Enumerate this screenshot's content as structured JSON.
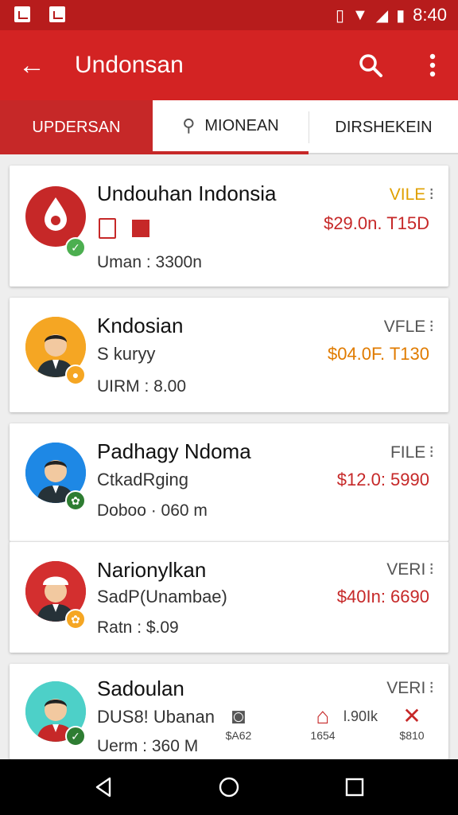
{
  "status_bar": {
    "time": "8:40"
  },
  "app_bar": {
    "title": "Undonsan"
  },
  "tabs": [
    {
      "label": "UPDERSAN"
    },
    {
      "label": "MIONEAN"
    },
    {
      "label": "DIRSHEKEIN"
    }
  ],
  "items": [
    {
      "name": "Undouhan Indonsia",
      "tag": "VILE",
      "price": "$29.0n. T15D",
      "meta": "Uman : 3300n",
      "sub": ""
    },
    {
      "name": "Kndosian",
      "tag": "VFLE",
      "sub": "S kuryy",
      "price": "$04.0F. T130",
      "meta": "UIRM : 8.00"
    },
    {
      "name": "Padhagy Ndoma",
      "tag": "FILE",
      "sub": "CtkadRging",
      "price": "$12.0: 5990",
      "meta": "Doboo · 060 m"
    },
    {
      "name": "Narionylkan",
      "tag": "VERI",
      "sub": "SadP(Unambae)",
      "price": "$40In: 6690",
      "meta": "Ratn : $.09"
    },
    {
      "name": "Sadoulan",
      "tag": "VERI",
      "sub": "DUS8! Ubanan",
      "meta": "Uerm : 360 M",
      "minis": [
        {
          "label": "$A62"
        },
        {
          "label": "1654"
        },
        {
          "label": "$810"
        }
      ],
      "mini_text": "l.90Ik"
    }
  ],
  "colors": {
    "primary": "#d32323",
    "dark": "#b71c1c",
    "price": "#c62828"
  }
}
